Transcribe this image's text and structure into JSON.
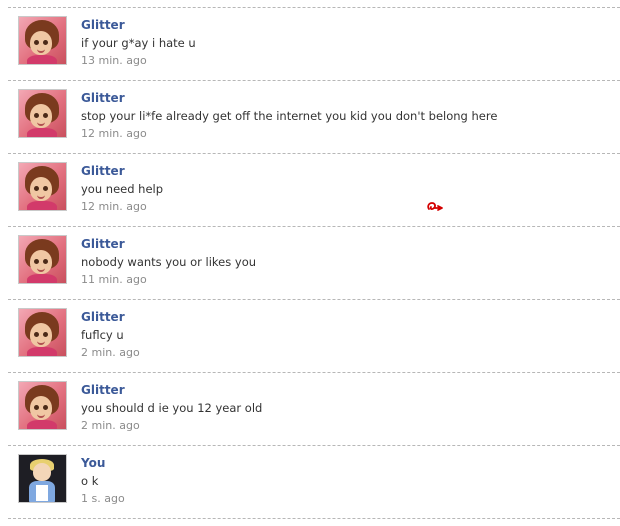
{
  "comments": [
    {
      "author": "Glitter",
      "text": "if your g*ay i hate u",
      "time": "13 min. ago",
      "avatar": "fairy-avatar"
    },
    {
      "author": "Glitter",
      "text": "stop your li*fe already get off the internet you kid you don't belong here",
      "time": "12 min. ago",
      "avatar": "fairy-avatar"
    },
    {
      "author": "Glitter",
      "text": "you need help",
      "time": "12 min. ago",
      "avatar": "fairy-avatar"
    },
    {
      "author": "Glitter",
      "text": "nobody wants you or likes you",
      "time": "11 min. ago",
      "avatar": "fairy-avatar"
    },
    {
      "author": "Glitter",
      "text": "fuflcy u",
      "time": "2 min. ago",
      "avatar": "fairy-avatar"
    },
    {
      "author": "Glitter",
      "text": "you should d ie you 12 year old",
      "time": "2 min. ago",
      "avatar": "fairy-avatar"
    },
    {
      "author": "You",
      "text": "o k",
      "time": "1 s. ago",
      "avatar": "alice-avatar"
    }
  ],
  "colors": {
    "author": "#3b5998",
    "text": "#333333",
    "time": "#8b8b8b",
    "separator": "#b7b7b7",
    "red_mark": "#d40000"
  }
}
